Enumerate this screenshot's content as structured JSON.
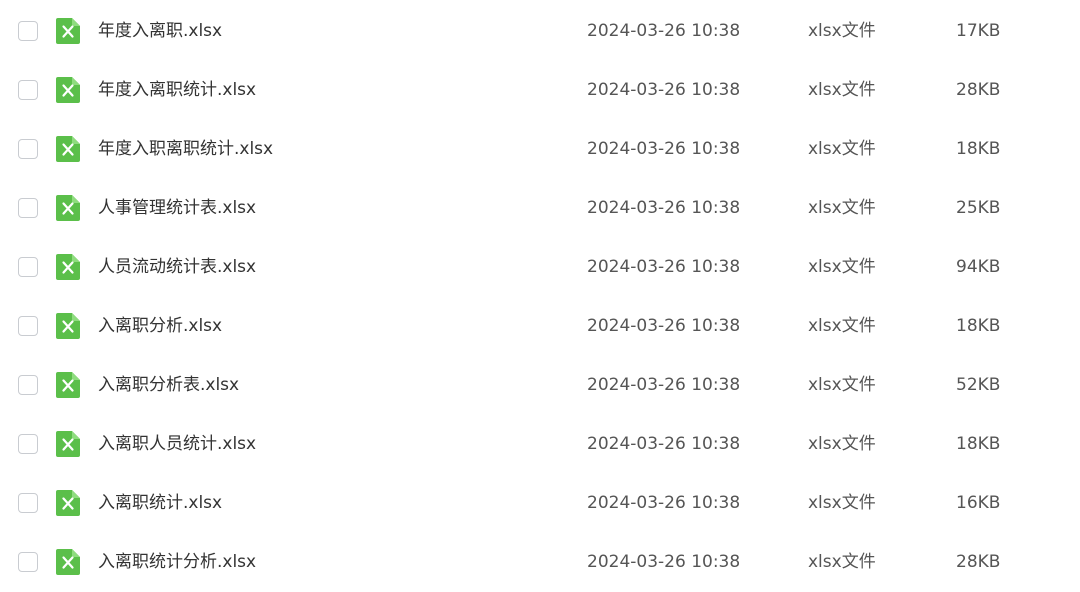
{
  "accent_color": "#5bbf4a",
  "icon_name": "excel-x-icon",
  "files": [
    {
      "name": "年度入离职.xlsx",
      "date": "2024-03-26 10:38",
      "type": "xlsx文件",
      "size": "17KB"
    },
    {
      "name": "年度入离职统计.xlsx",
      "date": "2024-03-26 10:38",
      "type": "xlsx文件",
      "size": "28KB"
    },
    {
      "name": "年度入职离职统计.xlsx",
      "date": "2024-03-26 10:38",
      "type": "xlsx文件",
      "size": "18KB"
    },
    {
      "name": "人事管理统计表.xlsx",
      "date": "2024-03-26 10:38",
      "type": "xlsx文件",
      "size": "25KB"
    },
    {
      "name": "人员流动统计表.xlsx",
      "date": "2024-03-26 10:38",
      "type": "xlsx文件",
      "size": "94KB"
    },
    {
      "name": "入离职分析.xlsx",
      "date": "2024-03-26 10:38",
      "type": "xlsx文件",
      "size": "18KB"
    },
    {
      "name": "入离职分析表.xlsx",
      "date": "2024-03-26 10:38",
      "type": "xlsx文件",
      "size": "52KB"
    },
    {
      "name": "入离职人员统计.xlsx",
      "date": "2024-03-26 10:38",
      "type": "xlsx文件",
      "size": "18KB"
    },
    {
      "name": "入离职统计.xlsx",
      "date": "2024-03-26 10:38",
      "type": "xlsx文件",
      "size": "16KB"
    },
    {
      "name": "入离职统计分析.xlsx",
      "date": "2024-03-26 10:38",
      "type": "xlsx文件",
      "size": "28KB"
    }
  ]
}
